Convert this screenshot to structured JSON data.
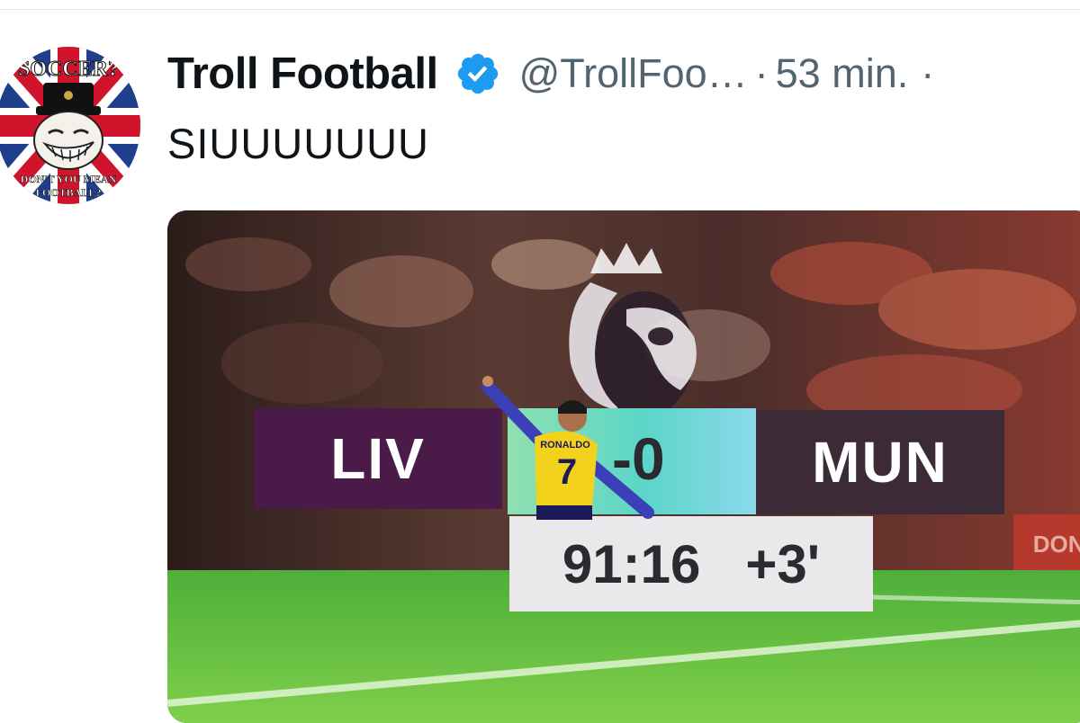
{
  "tweet": {
    "display_name": "Troll Football",
    "handle": "@TrollFoo…",
    "separator": "·",
    "time_ago": "53 min.",
    "more": "·",
    "text": "SIUUUUUUU",
    "verified_icon": "verified-badge-icon"
  },
  "avatar": {
    "top_text": "SOCCER?",
    "bottom_text": "DON'T YOU MEAN FOOTBALL?"
  },
  "media": {
    "scoreboard": {
      "home": "LIV",
      "score": "-0",
      "away": "MUN",
      "clock": "91:16",
      "added": "+3'"
    },
    "player_shirt_name": "RONALDO",
    "player_shirt_number": "7"
  },
  "colors": {
    "accent_blue": "#1d9bf0",
    "text_primary": "#0f1419",
    "text_secondary": "#536471"
  }
}
